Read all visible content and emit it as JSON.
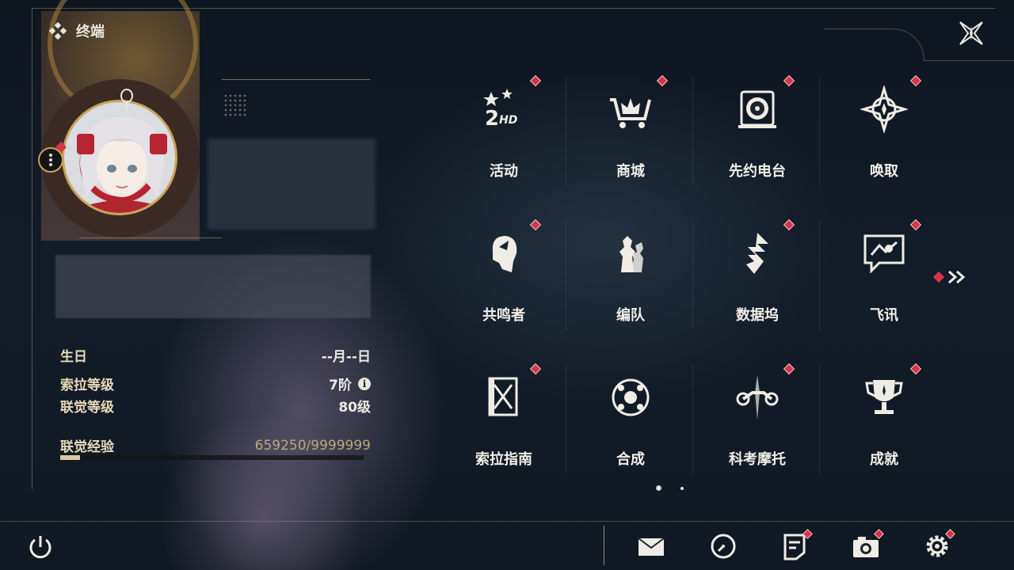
{
  "header": {
    "title": "终端",
    "title_icon": "diamond-cluster-icon",
    "close_icon": "close-star-icon"
  },
  "profile": {
    "birthday_label": "生日",
    "birthday_value": "--月--日",
    "rank_label": "索拉等级",
    "rank_value": "7阶",
    "rank_info_icon": "i",
    "union_label": "联觉等级",
    "union_value": "80级",
    "exp_label": "联觉经验",
    "exp_value": "659250/9999999",
    "exp_progress": 0.066
  },
  "menu": {
    "items": [
      {
        "label": "活动",
        "icon": "event-2hd-icon"
      },
      {
        "label": "商城",
        "icon": "shop-cart-icon"
      },
      {
        "label": "先约电台",
        "icon": "radio-disc-icon"
      },
      {
        "label": "唤取",
        "icon": "convene-star-icon"
      },
      {
        "label": "共鸣者",
        "icon": "resonator-head-icon"
      },
      {
        "label": "编队",
        "icon": "team-chess-icon"
      },
      {
        "label": "数据坞",
        "icon": "data-bank-icon"
      },
      {
        "label": "飞讯",
        "icon": "chat-bubble-icon"
      },
      {
        "label": "索拉指南",
        "icon": "guide-book-icon"
      },
      {
        "label": "合成",
        "icon": "synthesis-icon"
      },
      {
        "label": "科考摩托",
        "icon": "motorcycle-icon"
      },
      {
        "label": "成就",
        "icon": "trophy-icon"
      }
    ],
    "page": 1,
    "page_count": 2
  },
  "dock": [
    "mail-icon",
    "clock-icon",
    "notice-icon",
    "camera-icon",
    "settings-icon"
  ],
  "colors": {
    "badge": "#d6334a",
    "gold": "#caa35a",
    "label_gold": "#e7d9b8"
  }
}
